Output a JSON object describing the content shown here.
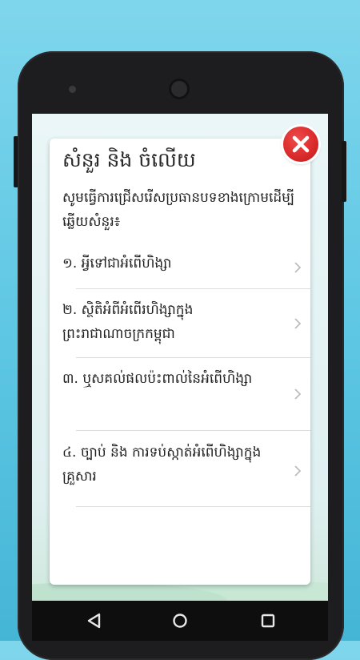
{
  "dialog": {
    "title": "សំនួរ និង ចំលើយ",
    "instruction": "សូមធ្វើការជ្រើសរើសប្រធានបទខាងក្រោមដើម្បីឆ្លើយសំនួរ៖",
    "items": [
      {
        "label": "១. អ្វីទៅជាអំពើហិង្សា"
      },
      {
        "label": "២. ស្ថិតិអំពីអំពើរហិង្សាក្នុងព្រះរាជាណាចក្រកម្ពុជា"
      },
      {
        "label": "៣. ឬសគល់ផលប៉ះពាល់នៃអំពើហិង្សា"
      },
      {
        "label": "៤. ច្បាប់ និង ការទប់ស្កាត់អំពើហិង្សាក្នុងគ្រួសារ"
      }
    ]
  },
  "icons": {
    "close": "close-icon",
    "chevron": "chevron-right-icon",
    "nav_back": "back-triangle-icon",
    "nav_home": "home-circle-icon",
    "nav_recent": "recent-square-icon"
  },
  "colors": {
    "close_button": "#d92a2a",
    "background": "#5cc6e3",
    "phone_body": "#1d1d1f",
    "card": "#ffffff"
  }
}
